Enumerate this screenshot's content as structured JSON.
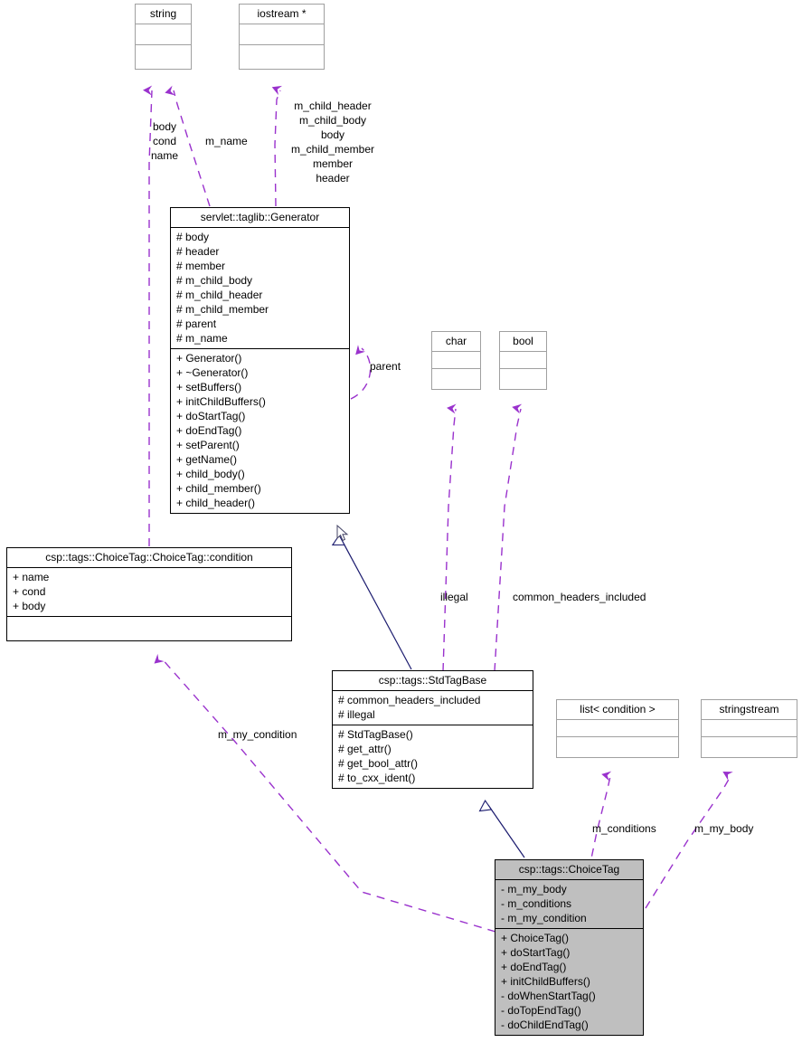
{
  "diagram": {
    "kind": "uml-collaboration-diagram",
    "colors": {
      "edge_aggregation": "#9a32cd",
      "edge_inheritance": "#1a1a6e",
      "box_border_plain": "#a0a0a0",
      "box_border_strong": "#000000",
      "highlight_fill": "#bfbfbf",
      "background": "#ffffff",
      "text": "#000000"
    }
  },
  "classes": {
    "string": {
      "title": "string",
      "attributes": [],
      "operations": []
    },
    "iostream": {
      "title": "iostream  *",
      "attributes": [],
      "operations": []
    },
    "generator": {
      "title": "servlet::taglib::Generator",
      "attributes": [
        "# body",
        "# header",
        "# member",
        "# m_child_body",
        "# m_child_header",
        "# m_child_member",
        "# parent",
        "# m_name"
      ],
      "operations": [
        "+ Generator()",
        "+ ~Generator()",
        "+ setBuffers()",
        "+ initChildBuffers()",
        "+ doStartTag()",
        "+ doEndTag()",
        "+ setParent()",
        "+ getName()",
        "+ child_body()",
        "+ child_member()",
        "+ child_header()"
      ]
    },
    "char": {
      "title": "char",
      "attributes": [],
      "operations": []
    },
    "bool": {
      "title": "bool",
      "attributes": [],
      "operations": []
    },
    "condition": {
      "title": "csp::tags::ChoiceTag::ChoiceTag::condition",
      "attributes": [
        "+ name",
        "+ cond",
        "+ body"
      ],
      "operations": []
    },
    "stdtagbase": {
      "title": "csp::tags::StdTagBase",
      "attributes": [
        "# common_headers_included",
        "# illegal"
      ],
      "operations": [
        "# StdTagBase()",
        "# get_attr()",
        "# get_bool_attr()",
        "# to_cxx_ident()"
      ]
    },
    "list_condition": {
      "title": "list< condition >",
      "attributes": [],
      "operations": []
    },
    "stringstream": {
      "title": "stringstream",
      "attributes": [],
      "operations": []
    },
    "choicetag": {
      "title": "csp::tags::ChoiceTag",
      "attributes": [
        "- m_my_body",
        "- m_conditions",
        "- m_my_condition"
      ],
      "operations": [
        "+ ChoiceTag()",
        "+ doStartTag()",
        "+ doEndTag()",
        "+ initChildBuffers()",
        "- doWhenStartTag()",
        "- doTopEndTag()",
        "- doChildEndTag()"
      ]
    }
  },
  "edge_labels": {
    "condition_to_string": "body\ncond\nname",
    "generator_m_name": "m_name",
    "generator_to_iostream": "m_child_header\nm_child_body\nbody\nm_child_member\nmember\nheader",
    "generator_parent": "parent",
    "stdtagbase_illegal": "illegal",
    "stdtagbase_common_headers": "common_headers_included",
    "choicetag_m_my_condition": "m_my_condition",
    "choicetag_m_conditions": "m_conditions",
    "choicetag_m_my_body": "m_my_body"
  }
}
